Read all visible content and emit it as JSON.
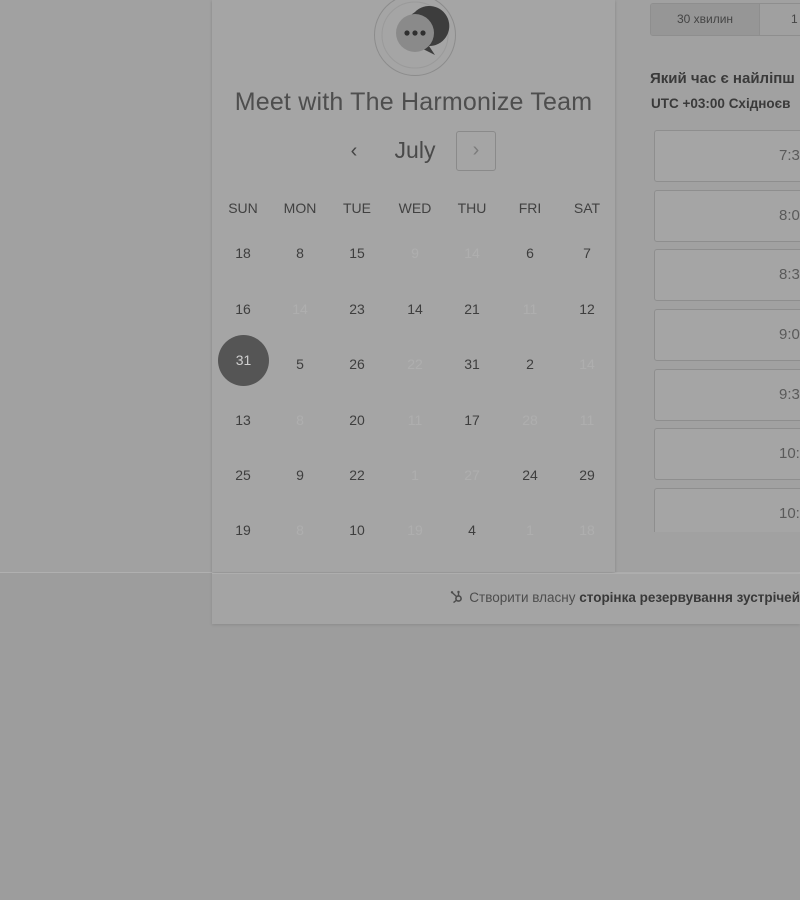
{
  "page": {
    "title": "Meet with The Harmonize Team"
  },
  "calendar": {
    "month": "July",
    "prev_icon": "‹",
    "next_icon": "›",
    "weekdays": [
      "SUN",
      "MON",
      "TUE",
      "WED",
      "THU",
      "FRI",
      "SAT"
    ],
    "weeks": [
      [
        "18",
        "8",
        "15",
        "9",
        "14",
        "6",
        "7"
      ],
      [
        "16",
        "14",
        "23",
        "14",
        "21",
        "11",
        "12"
      ],
      [
        "31",
        "5",
        "26",
        "22",
        "31",
        "2",
        "14"
      ],
      [
        "13",
        "8",
        "20",
        "11",
        "17",
        "28",
        "11"
      ],
      [
        "25",
        "9",
        "22",
        "1",
        "27",
        "24",
        "29"
      ],
      [
        "19",
        "8",
        "10",
        "19",
        "4",
        "1",
        "18"
      ]
    ],
    "disabled": [
      [
        false,
        false,
        false,
        true,
        true,
        false,
        false
      ],
      [
        false,
        true,
        false,
        false,
        false,
        true,
        false
      ],
      [
        false,
        false,
        false,
        true,
        false,
        false,
        true
      ],
      [
        false,
        true,
        false,
        true,
        false,
        true,
        true
      ],
      [
        false,
        false,
        false,
        true,
        true,
        false,
        false
      ],
      [
        false,
        true,
        false,
        true,
        false,
        true,
        true
      ]
    ],
    "selected": {
      "week": 2,
      "day": 0
    }
  },
  "duration": {
    "tab_30": "30 хвилин",
    "tab_next": "1"
  },
  "times": {
    "question": "Який час є найліпш",
    "timezone_offset": "UTC +03:00",
    "timezone_name": "Східноєв",
    "slots": [
      "7:3",
      "8:0",
      "8:3",
      "9:0",
      "9:3",
      "10:",
      "10:"
    ]
  },
  "footer": {
    "text_prefix": "Створити власну",
    "text_bold": "сторінка резервування зустрічей"
  },
  "colors": {
    "selected_day": "#555555",
    "page_bg": "#9d9d9d"
  }
}
